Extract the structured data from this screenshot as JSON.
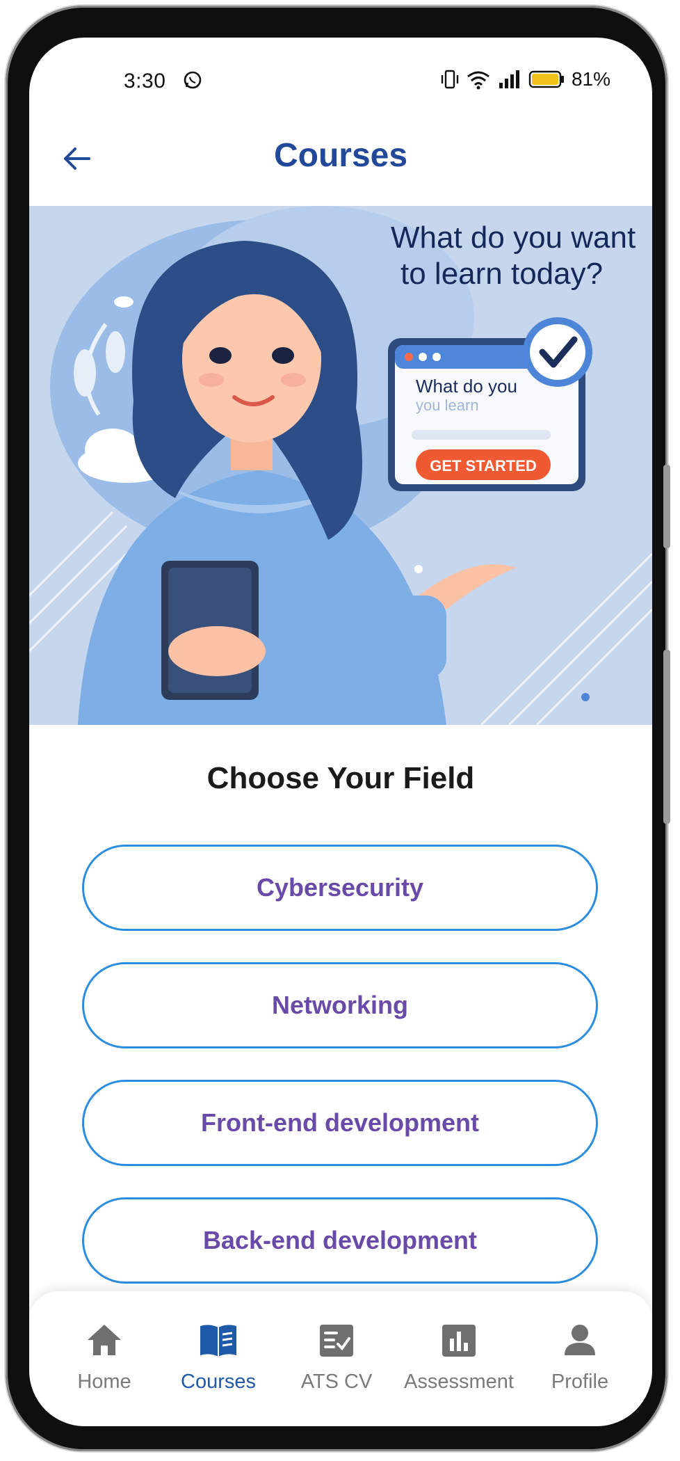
{
  "status_bar": {
    "time": "3:30",
    "battery": "81%"
  },
  "header": {
    "title": "Courses"
  },
  "hero": {
    "headline_line1": "What do you want",
    "headline_line2": "to learn today?",
    "card_text1": "What do you",
    "card_text2": "you learn",
    "card_button": "GET STARTED"
  },
  "section": {
    "title": "Choose Your Field"
  },
  "fields": [
    {
      "label": "Cybersecurity"
    },
    {
      "label": "Networking"
    },
    {
      "label": "Front-end development"
    },
    {
      "label": "Back-end development"
    }
  ],
  "nav": {
    "active": "Courses",
    "items": [
      {
        "label": "Home",
        "icon": "home-icon"
      },
      {
        "label": "Courses",
        "icon": "book-icon"
      },
      {
        "label": "ATS CV",
        "icon": "checklist-icon"
      },
      {
        "label": "Assessment",
        "icon": "bar-chart-icon"
      },
      {
        "label": "Profile",
        "icon": "person-icon"
      }
    ]
  },
  "colors": {
    "title_blue": "#22489a",
    "button_border": "#2b8de0",
    "button_text": "#6a4aa8",
    "nav_active": "#1e5aa8",
    "nav_inactive": "#7a7a7a"
  }
}
